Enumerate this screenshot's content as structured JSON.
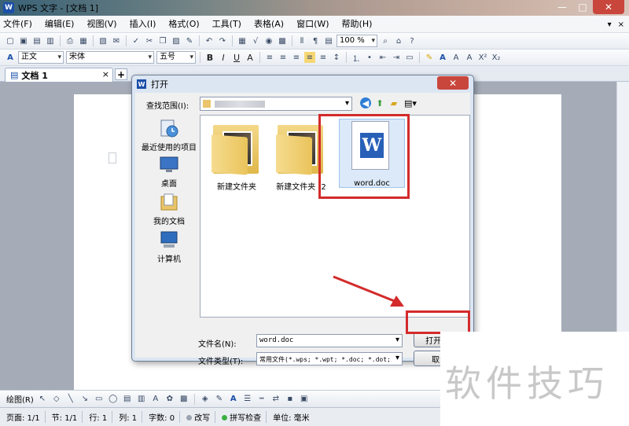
{
  "window": {
    "title": "WPS 文字 - [文档 1]",
    "logo": "W",
    "accent_color": "#1b4fa8",
    "close_color": "#c9463d"
  },
  "menubar": {
    "items": [
      "文件(F)",
      "编辑(E)",
      "视图(V)",
      "插入(I)",
      "格式(O)",
      "工具(T)",
      "表格(A)",
      "窗口(W)",
      "帮助(H)"
    ],
    "right_controls": [
      "▾",
      "×"
    ]
  },
  "toolbar": {
    "zoom": "100 %"
  },
  "format_toolbar": {
    "style": "正文",
    "font": "宋体",
    "size": "五号",
    "bold": "B",
    "italic": "I",
    "underline": "U",
    "font_color": "A"
  },
  "tabs": {
    "doc_tab": "文档 1",
    "close": "×",
    "add": "+"
  },
  "dialog": {
    "title": "打开",
    "close": "✕",
    "look_in_label": "查找范围(I):",
    "places": [
      {
        "label": "最近使用的项目",
        "icon": "recent-items-icon"
      },
      {
        "label": "桌面",
        "icon": "desktop-icon"
      },
      {
        "label": "我的文档",
        "icon": "my-documents-icon"
      },
      {
        "label": "计算机",
        "icon": "computer-icon"
      }
    ],
    "files": [
      {
        "name": "新建文件夹",
        "type": "folder"
      },
      {
        "name": "新建文件夹 (2",
        "type": "folder"
      },
      {
        "name": "word.doc",
        "type": "word-document"
      }
    ],
    "filename_label": "文件名(N):",
    "filename_value": "word.doc",
    "filetype_label": "文件类型(T):",
    "filetype_value": "常用文件(*.wps; *.wpt; *.doc; *.dot;",
    "open_button": "打开(O)",
    "cancel_button": "取消",
    "highlight_color": "#d32b2b"
  },
  "drawbar": {
    "draw_label": "绘图(R)"
  },
  "statusbar": {
    "page": "页面: 1/1",
    "section": "节: 1/1",
    "row": "行: 1",
    "col": "列: 1",
    "chars": "字数: 0",
    "revise": "改写",
    "spell": "拼写检查",
    "unit": "单位: 毫米"
  },
  "watermark": "软件技巧"
}
